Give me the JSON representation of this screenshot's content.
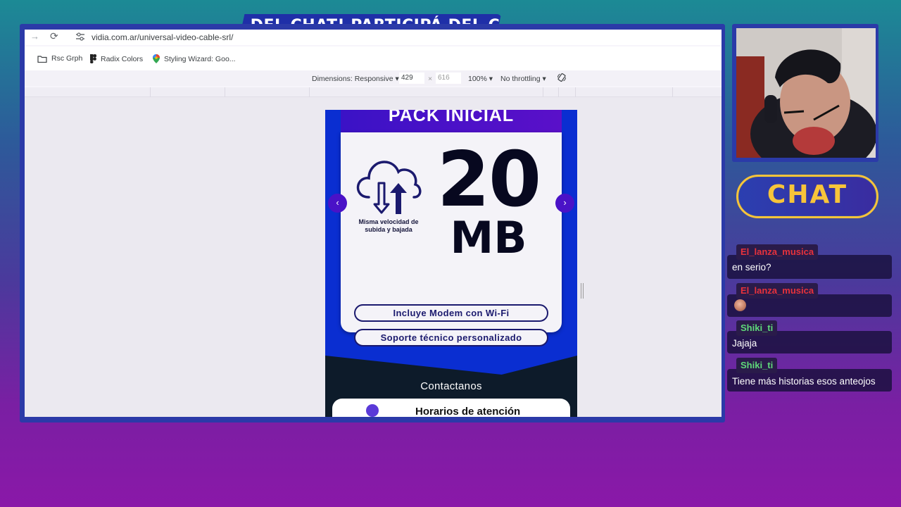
{
  "stream_banner": {
    "text": "A DEL CHAT!   PARTICIPÁ DEL C"
  },
  "browser": {
    "url": "vidia.com.ar/universal-video-cable-srl/",
    "bookmarks": [
      {
        "label": "Rsc Grph",
        "icon": "folder-icon"
      },
      {
        "label": "Radix Colors",
        "icon": "figma-icon"
      },
      {
        "label": "Styling Wizard: Goo...",
        "icon": "maps-pin-icon"
      }
    ],
    "devtools": {
      "dimensions_label": "Dimensions: Responsive",
      "width": "429",
      "times": "×",
      "height": "616",
      "zoom": "100%",
      "throttling": "No throttling"
    }
  },
  "page": {
    "pack_title": "PACK INICIAL",
    "speed_label": "Misma velocidad de subida y bajada",
    "big_number": "20",
    "big_unit": "MB",
    "features": [
      "Incluye Modem con Wi-Fi",
      "Soporte técnico personalizado"
    ],
    "prev_arrow": "‹",
    "next_arrow": "›",
    "contact_title": "Contactanos",
    "hours_label": "Horarios de atención"
  },
  "chat": {
    "logo": "CHAT",
    "messages": [
      {
        "user": "El_lanza_musica",
        "user_color": "#e8323c",
        "text": "en serio?"
      },
      {
        "user": "El_lanza_musica",
        "user_color": "#e8323c",
        "text": "",
        "emote": "face-emote"
      },
      {
        "user": "Shiki_ti",
        "user_color": "#5fd97a",
        "text": "Jajaja"
      },
      {
        "user": "Shiki_ti",
        "user_color": "#5fd97a",
        "text": "Tiene más historias esos anteojos"
      }
    ]
  }
}
